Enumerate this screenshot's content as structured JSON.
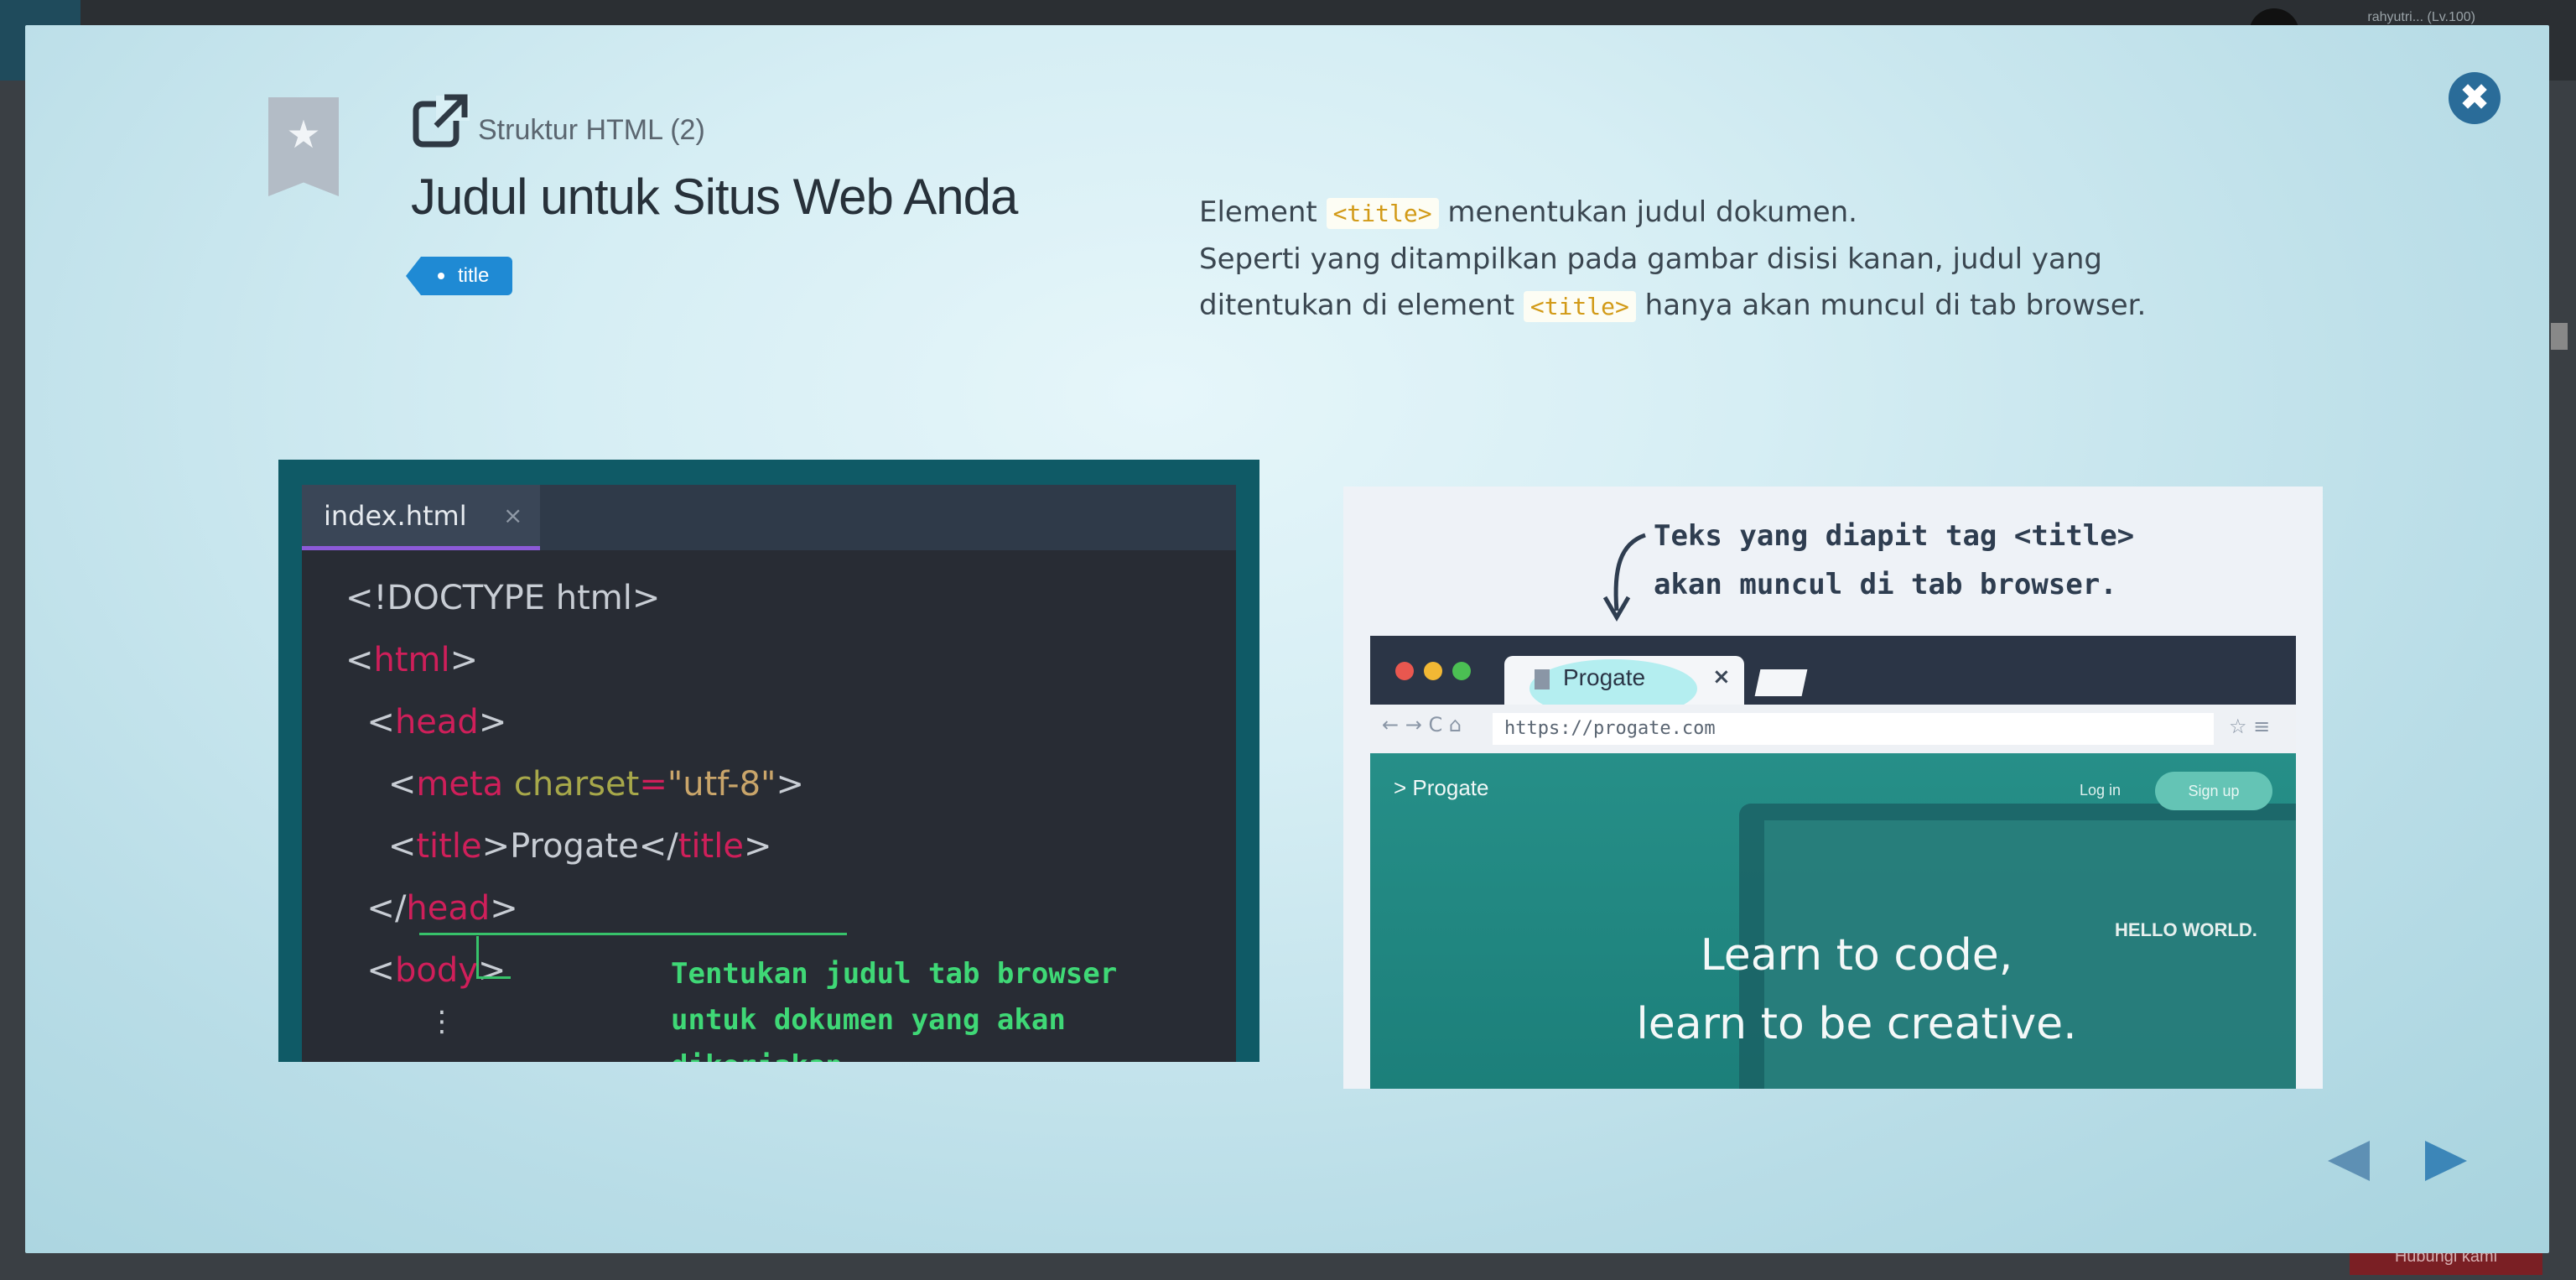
{
  "background": {
    "user_label": "rahyutri... (Lv.100)",
    "hint_button": "Hubungi kami"
  },
  "modal": {
    "subtitle": "Struktur HTML (2)",
    "title": "Judul untuk Situs Web Anda",
    "tag": "title",
    "description": {
      "line1_a": "Element",
      "line1_code": "<title>",
      "line1_b": "menentukan judul dokumen.",
      "line2": "Seperti yang ditampilkan pada gambar disisi kanan, judul yang",
      "line3_a": "ditentukan di element",
      "line3_code": "<title>",
      "line3_b": "hanya akan muncul di tab browser."
    },
    "close_label": "✖",
    "bookmark_icon": "star-icon",
    "external_icon": "external-link-icon"
  },
  "editor": {
    "tab_name": "index.html",
    "tab_close": "×",
    "lines": [
      "<!DOCTYPE html>",
      "<html>",
      "<head>",
      "<meta charset=\"utf-8\">",
      "<title>Progate</title>",
      "</head>",
      "<body>"
    ],
    "annotation": "Tentukan judul tab browser untuk dokumen yang akan dikerjakan."
  },
  "browser": {
    "annotation_line1": "Teks yang diapit tag <title>",
    "annotation_line2": "akan muncul di tab browser.",
    "tab_label": "Progate",
    "tab_close": "×",
    "url": "https://progate.com",
    "site_logo": "> Progate",
    "login": "Log in",
    "signup": "Sign up",
    "hero_line1": "Learn to code,",
    "hero_line2": "learn to be creative.",
    "laptop_text": "HELLO WORLD."
  },
  "nav": {
    "prev_icon": "triangle-left-icon",
    "next_icon": "triangle-right-icon"
  }
}
